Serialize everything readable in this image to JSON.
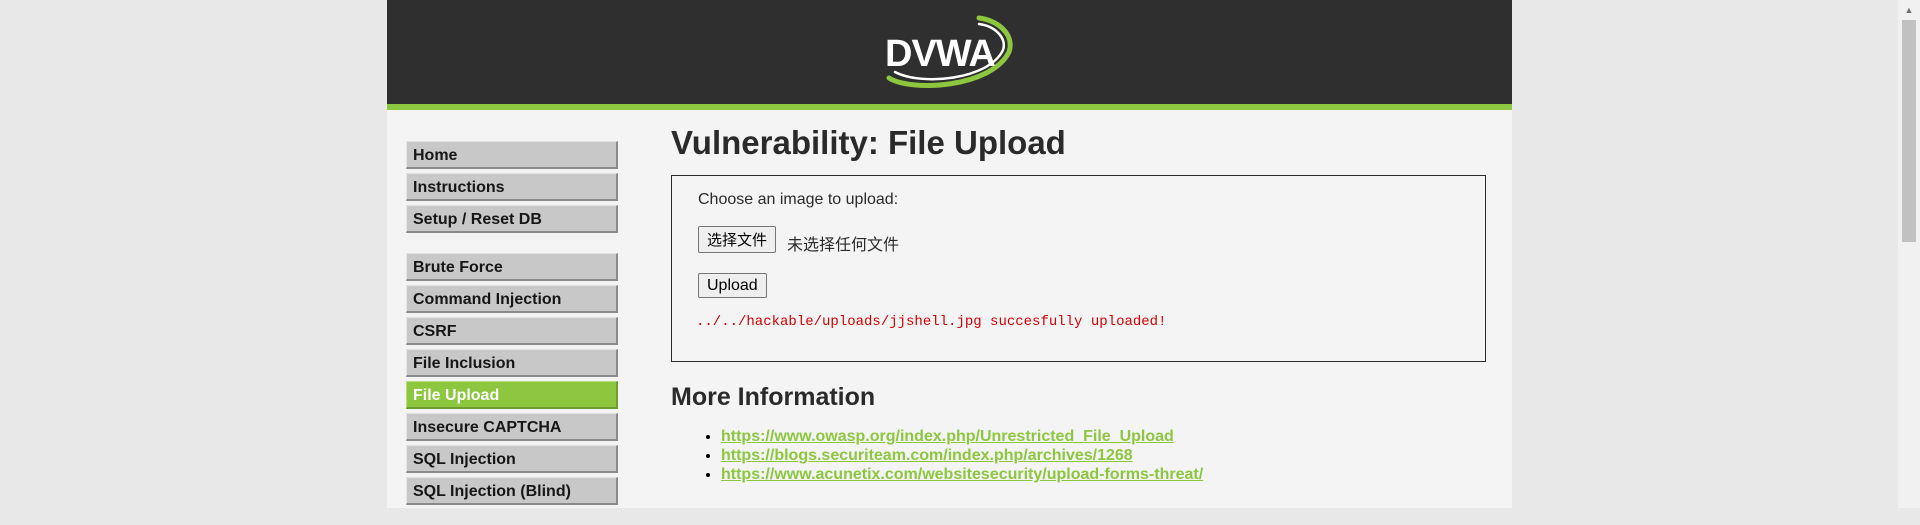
{
  "header": {
    "logo_text": "DVWA"
  },
  "menu": {
    "groups": [
      [
        {
          "label": "Home"
        },
        {
          "label": "Instructions"
        },
        {
          "label": "Setup / Reset DB"
        }
      ],
      [
        {
          "label": "Brute Force"
        },
        {
          "label": "Command Injection"
        },
        {
          "label": "CSRF"
        },
        {
          "label": "File Inclusion"
        },
        {
          "label": "File Upload",
          "selected": true
        },
        {
          "label": "Insecure CAPTCHA"
        },
        {
          "label": "SQL Injection"
        },
        {
          "label": "SQL Injection (Blind)"
        }
      ]
    ]
  },
  "main": {
    "title": "Vulnerability: File Upload",
    "upload_form": {
      "label": "Choose an image to upload:",
      "file_button": "选择文件",
      "file_status": "未选择任何文件",
      "upload_button": "Upload"
    },
    "result_message": "../../hackable/uploads/jjshell.jpg succesfully uploaded!",
    "more_info_title": "More Information",
    "links": [
      "https://www.owasp.org/index.php/Unrestricted_File_Upload",
      "https://blogs.securiteam.com/index.php/archives/1268",
      "https://www.acunetix.com/websitesecurity/upload-forms-threat/"
    ]
  },
  "colors": {
    "accent": "#8dc63f",
    "header_bg": "#2f2f2f",
    "error_text": "#d20000"
  },
  "scrollbar": {
    "up_arrow_icon": "▲"
  }
}
